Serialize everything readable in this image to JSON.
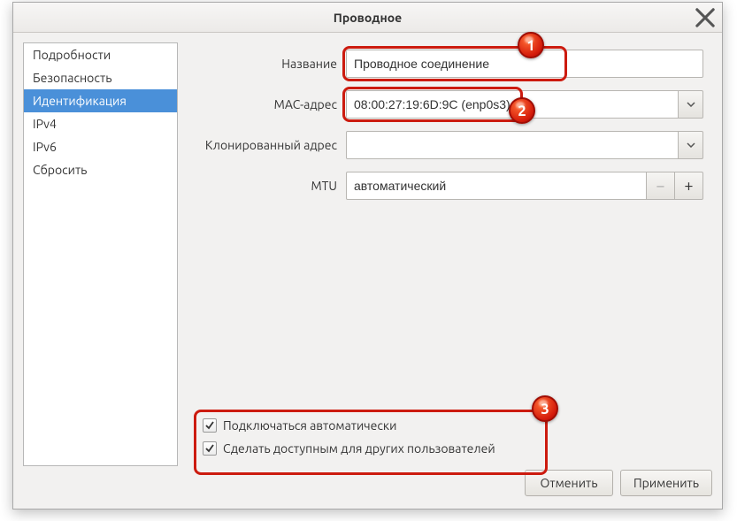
{
  "window": {
    "title": "Проводное"
  },
  "sidebar": {
    "items": [
      {
        "label": "Подробности"
      },
      {
        "label": "Безопасность"
      },
      {
        "label": "Идентификация",
        "active": true
      },
      {
        "label": "IPv4"
      },
      {
        "label": "IPv6"
      },
      {
        "label": "Сбросить"
      }
    ]
  },
  "form": {
    "name_label": "Название",
    "name_value": "Проводное соединение",
    "mac_label": "MAC-адрес",
    "mac_value": "08:00:27:19:6D:9C (enp0s3)",
    "cloned_label": "Клонированный адрес",
    "cloned_value": "",
    "mtu_label": "MTU",
    "mtu_value": "автоматический",
    "mtu_minus": "−",
    "mtu_plus": "+"
  },
  "checks": {
    "auto_connect": "Подключаться автоматически",
    "all_users": "Сделать доступным для других пользователей"
  },
  "footer": {
    "cancel": "Отменить",
    "apply": "Применить"
  },
  "annotations": {
    "b1": "1",
    "b2": "2",
    "b3": "3"
  }
}
